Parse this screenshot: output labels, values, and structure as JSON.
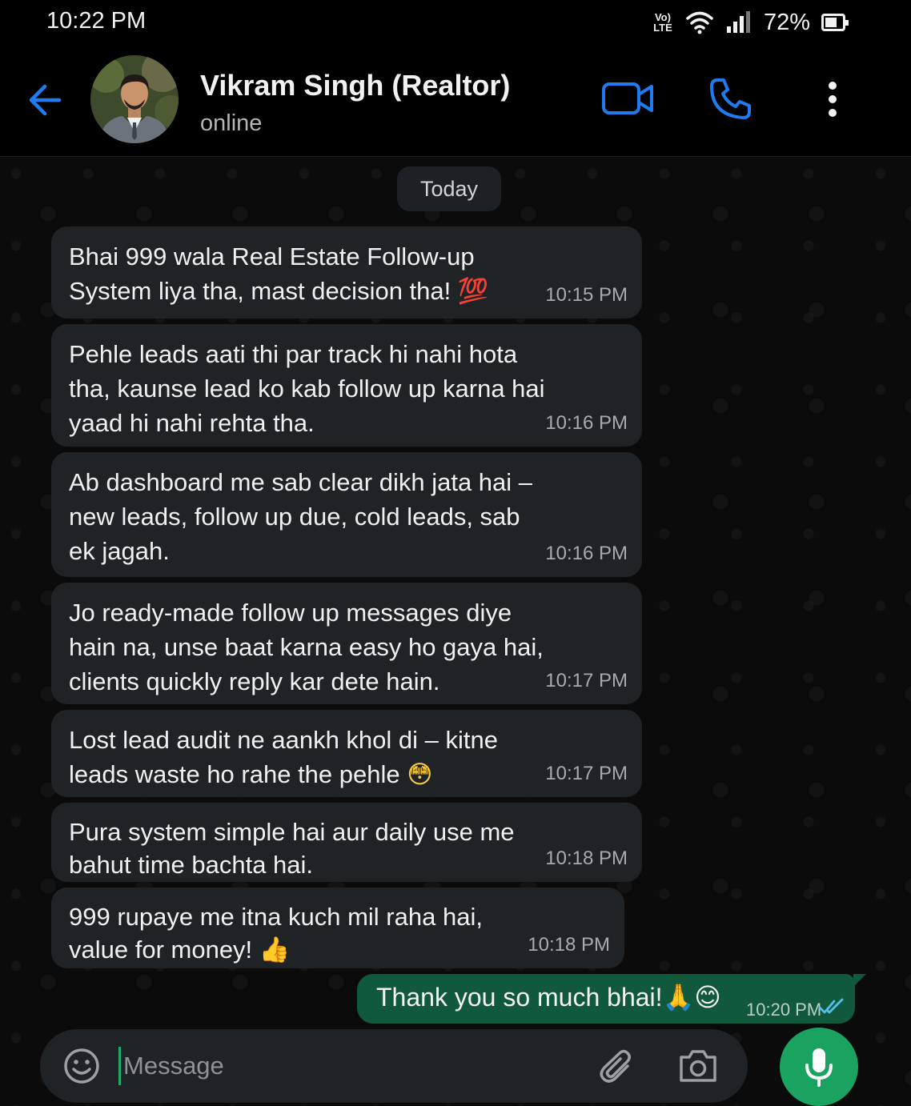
{
  "status_bar": {
    "time": "10:22 PM",
    "volte_top": "Vo)",
    "volte_bottom": "LTE",
    "battery": "72%"
  },
  "header": {
    "contact_name": "Vikram Singh (Realtor)",
    "contact_status": "online",
    "icons": [
      "back-arrow-icon",
      "video-call-icon",
      "phone-icon",
      "more-vert-icon"
    ],
    "accent_color": "#1f7cf0"
  },
  "chat": {
    "date_chip": "Today",
    "messages": [
      {
        "text": "Bhai 999 wala Real Estate Follow-up\nSystem liya tha, mast decision tha! ",
        "emoji": "💯",
        "time": "10:15 PM"
      },
      {
        "text": "Pehle leads aati thi par track hi nahi hota\ntha, kaunse lead ko kab follow up karna hai\nyaad hi nahi rehta tha.",
        "emoji": "",
        "time": "10:16 PM"
      },
      {
        "text": "Ab dashboard me sab clear dikh jata hai –\nnew leads, follow up due, cold leads, sab\nek jagah.",
        "emoji": "",
        "time": "10:16 PM"
      },
      {
        "text": "Jo ready-made follow up messages diye\nhain na, unse baat karna easy ho gaya hai,\nclients quickly reply kar dete hain.",
        "emoji": "",
        "time": "10:17 PM"
      },
      {
        "text": "Lost lead audit ne aankh khol di – kitne\nleads waste ho rahe the pehle ",
        "emoji": "😳",
        "time": "10:17 PM"
      },
      {
        "text": "Pura system simple hai aur daily use me\nbahut time bachta hai.",
        "emoji": "",
        "time": "10:18 PM"
      },
      {
        "text": "999 rupaye me itna kuch mil raha hai,\nvalue for money! ",
        "emoji": "👍",
        "time": "10:18 PM"
      }
    ],
    "outgoing": {
      "text": "Thank you so much bhai!🙏😊",
      "time": "10:20 PM",
      "status": "read"
    }
  },
  "composer": {
    "placeholder": "Message",
    "icons": [
      "emoji-icon",
      "attach-icon",
      "camera-icon",
      "mic-icon"
    ],
    "send_color": "#1aa260"
  }
}
